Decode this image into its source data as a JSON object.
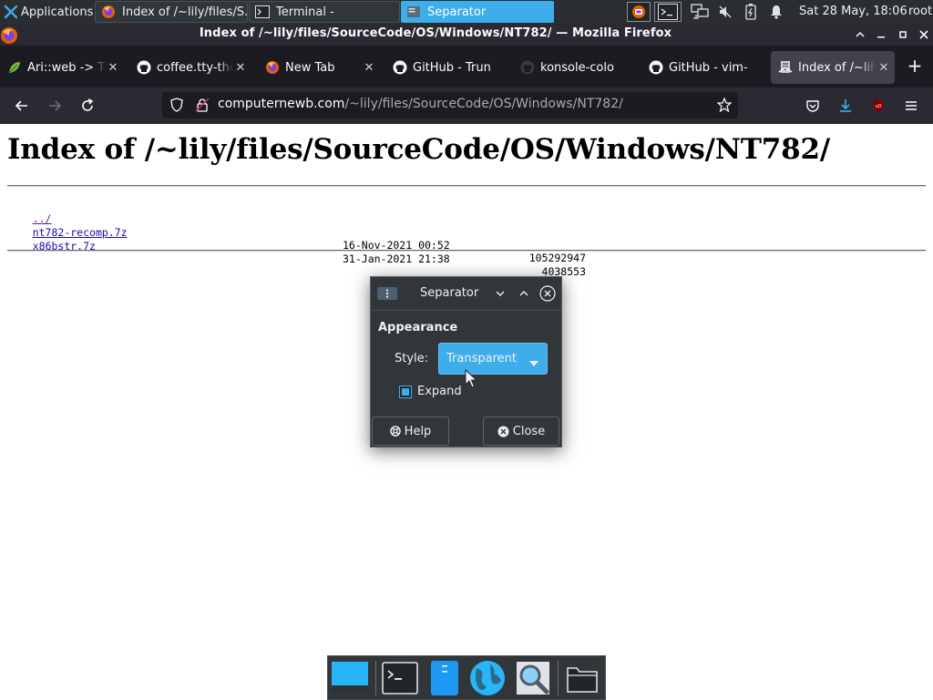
{
  "top_panel": {
    "applications_label": "Applications",
    "taskbar": [
      {
        "label": "Index of /~lily/files/S...",
        "icon": "firefox-icon",
        "active": false
      },
      {
        "label": "Terminal -",
        "icon": "terminal-icon",
        "active": false
      },
      {
        "label": "Separator",
        "icon": "panel-icon",
        "active": true
      }
    ],
    "clock": "Sat 28 May, 18:06",
    "user": "root"
  },
  "firefox": {
    "window_title": "Index of /~lily/files/SourceCode/OS/Windows/NT782/ — Mozilla Firefox",
    "tabs": [
      {
        "label": "Ari::web -> TTY",
        "icon": "leaf-icon",
        "selected": false
      },
      {
        "label": "coffee.tty-the",
        "icon": "github-icon",
        "selected": false
      },
      {
        "label": "New Tab",
        "icon": "firefox-icon",
        "selected": false
      },
      {
        "label": "GitHub - Trun",
        "icon": "github-icon",
        "selected": false
      },
      {
        "label": "konsole-colo",
        "icon": "github-dark-icon",
        "selected": false
      },
      {
        "label": "GitHub - vim-",
        "icon": "github-icon",
        "selected": false
      },
      {
        "label": "Index of /~lily",
        "icon": "page-icon",
        "selected": true
      }
    ],
    "url_host": "computernewb.com",
    "url_path": "/~lily/files/SourceCode/OS/Windows/NT782/"
  },
  "page": {
    "heading": "Index of /~lily/files/SourceCode/OS/Windows/NT782/",
    "parent_link": "../",
    "files": [
      {
        "name": "nt782-recomp.7z",
        "date": "16-Nov-2021 00:52",
        "size": "105292947"
      },
      {
        "name": "x86bstr.7z",
        "date": "31-Jan-2021 21:38",
        "size": "4038553"
      }
    ]
  },
  "dialog": {
    "title": "Separator",
    "section": "Appearance",
    "style_label": "Style:",
    "style_value": "Transparent",
    "expand_label": "Expand",
    "expand_checked": true,
    "help_label": "Help",
    "close_label": "Close"
  },
  "dock": {
    "items": [
      "show-desktop-icon",
      "terminal-icon",
      "file-manager-icon",
      "web-browser-icon",
      "app-finder-icon",
      "folder-icon"
    ]
  },
  "colors": {
    "accent": "#3daee9",
    "panel_bg": "#2a2e32",
    "dialog_bg": "#31363b",
    "firefox_toolbar": "#2b2a33"
  }
}
